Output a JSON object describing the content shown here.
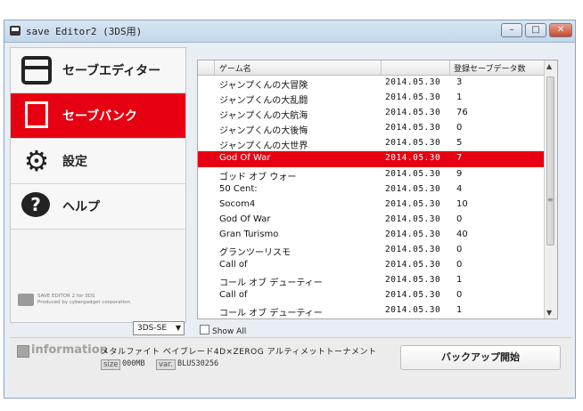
{
  "window": {
    "title": "save Editor2 (3DS用)"
  },
  "window_buttons": {
    "min": "–",
    "max": "□",
    "close": "✕"
  },
  "sidebar": {
    "items": [
      {
        "label": "セーブエディター",
        "icon": "save-editor-icon",
        "active": false
      },
      {
        "label": "セーブバンク",
        "icon": "save-bank-icon",
        "active": true
      },
      {
        "label": "設定",
        "icon": "gear-icon",
        "active": false
      },
      {
        "label": "ヘルプ",
        "icon": "help-icon",
        "active": false
      }
    ],
    "brand_line1": "SAVE EDITOR 2 for 3DS",
    "brand_line2": "Produced by cybergadget corporation"
  },
  "device_select": {
    "selected": "3DS-SE"
  },
  "table": {
    "headers": {
      "name": "ゲーム名",
      "date": "",
      "count": "登録セーブデータ数"
    },
    "rows": [
      {
        "name": "ジャンプくんの大冒険",
        "date": "2014.05.30",
        "count": "3"
      },
      {
        "name": "ジャンプくんの大乱闘",
        "date": "2014.05.30",
        "count": "1"
      },
      {
        "name": "ジャンプくんの大航海",
        "date": "2014.05.30",
        "count": "76"
      },
      {
        "name": "ジャンプくんの大後悔",
        "date": "2014.05.30",
        "count": "0"
      },
      {
        "name": "ジャンプくんの大世界",
        "date": "2014.05.30",
        "count": "5"
      },
      {
        "name": "God Of War",
        "date": "2014.05.30",
        "count": "7",
        "selected": true
      },
      {
        "name": "ゴッド オブ ウォー",
        "date": "2014.05.30",
        "count": "9"
      },
      {
        "name": "50 Cent:",
        "date": "2014.05.30",
        "count": "4"
      },
      {
        "name": "Socom4",
        "date": "2014.05.30",
        "count": "10"
      },
      {
        "name": "God Of War",
        "date": "2014.05.30",
        "count": "0"
      },
      {
        "name": "Gran Turismo",
        "date": "2014.05.30",
        "count": "40"
      },
      {
        "name": "グランツーリスモ",
        "date": "2014.05.30",
        "count": "0"
      },
      {
        "name": "Call of",
        "date": "2014.05.30",
        "count": "0"
      },
      {
        "name": "コール オブ デューティー",
        "date": "2014.05.30",
        "count": "1"
      },
      {
        "name": "Call of",
        "date": "2014.05.30",
        "count": "0"
      },
      {
        "name": "コール オブ デューティー",
        "date": "2014.05.30",
        "count": "1"
      }
    ]
  },
  "show_all": {
    "label": "Show All",
    "checked": false
  },
  "information": {
    "label": "information",
    "title": "メタルファイト ベイブレード4D×ZEROG アルティメットトーナメント",
    "size_label": "size",
    "size_value": "000MB",
    "var_label": "var.",
    "var_value": "BLUS30256"
  },
  "backup_button": {
    "label": "バックアップ開始"
  },
  "colors": {
    "accent": "#e60012"
  }
}
